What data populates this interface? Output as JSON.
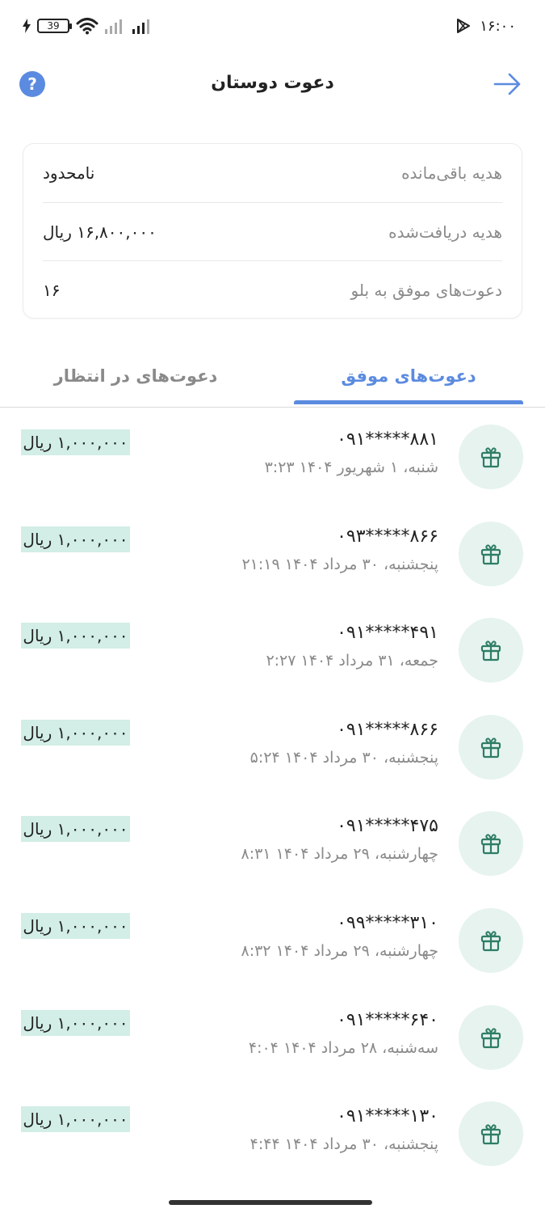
{
  "status_bar": {
    "battery": "39",
    "time": "۱۶:۰۰"
  },
  "header": {
    "title": "دعوت دوستان",
    "help_symbol": "?",
    "help_icon": "question-circle-icon",
    "back_icon": "arrow-right-icon"
  },
  "summary": {
    "rows": [
      {
        "label": "هدیه باقی‌مانده",
        "value": "نامحدود"
      },
      {
        "label": "هدیه دریافت‌شده",
        "value": "۱۶,۸۰۰,۰۰۰ ریال"
      },
      {
        "label": "دعوت‌های موفق به بلو",
        "value": "۱۶"
      }
    ]
  },
  "tabs": {
    "active": "دعوت‌های موفق",
    "inactive": "دعوت‌های در انتظار"
  },
  "invites": [
    {
      "phone": "۰۹۱*****۸۸۱",
      "date": "شنبه، ۱ شهریور ۱۴۰۴ ۳:۲۳",
      "amount": "۱,۰۰۰,۰۰۰ ریال"
    },
    {
      "phone": "۰۹۳*****۸۶۶",
      "date": "پنجشنبه، ۳۰ مرداد ۱۴۰۴ ۲۱:۱۹",
      "amount": "۱,۰۰۰,۰۰۰ ریال"
    },
    {
      "phone": "۰۹۱*****۴۹۱",
      "date": "جمعه، ۳۱ مرداد ۱۴۰۴ ۲:۲۷",
      "amount": "۱,۰۰۰,۰۰۰ ریال"
    },
    {
      "phone": "۰۹۱*****۸۶۶",
      "date": "پنجشنبه، ۳۰ مرداد ۱۴۰۴ ۵:۲۴",
      "amount": "۱,۰۰۰,۰۰۰ ریال"
    },
    {
      "phone": "۰۹۱*****۴۷۵",
      "date": "چهارشنبه، ۲۹ مرداد ۱۴۰۴ ۸:۳۱",
      "amount": "۱,۰۰۰,۰۰۰ ریال"
    },
    {
      "phone": "۰۹۹*****۳۱۰",
      "date": "چهارشنبه، ۲۹ مرداد ۱۴۰۴ ۸:۳۲",
      "amount": "۱,۰۰۰,۰۰۰ ریال"
    },
    {
      "phone": "۰۹۱*****۶۴۰",
      "date": "سه‌شنبه، ۲۸ مرداد ۱۴۰۴ ۴:۰۴",
      "amount": "۱,۰۰۰,۰۰۰ ریال"
    },
    {
      "phone": "۰۹۱*****۱۳۰",
      "date": "پنجشنبه، ۳۰ مرداد ۱۴۰۴ ۴:۴۴",
      "amount": "۱,۰۰۰,۰۰۰ ریال"
    }
  ],
  "colors": {
    "accent": "#5b8be0",
    "gift_bg": "#e6f3ef",
    "gift_icon": "#2e7d64",
    "amount_bg": "#d2eee6"
  }
}
